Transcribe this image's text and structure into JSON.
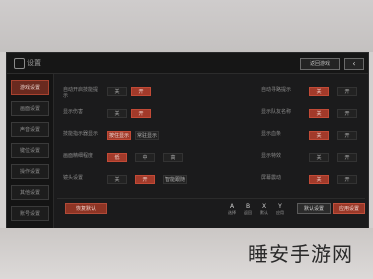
{
  "window": {
    "title": "设置",
    "tab": "返回游戏",
    "back_icon": "back-arrow-icon"
  },
  "sidebar": {
    "items": [
      {
        "label": "游戏设置",
        "active": true
      },
      {
        "label": "画面设置",
        "active": false
      },
      {
        "label": "声音设置",
        "active": false
      },
      {
        "label": "键位设置",
        "active": false
      },
      {
        "label": "操作设置",
        "active": false
      },
      {
        "label": "其他设置",
        "active": false
      },
      {
        "label": "账号设置",
        "active": false
      }
    ]
  },
  "settings_left": [
    {
      "label": "自动开启技能提示",
      "options": [
        "关",
        "开"
      ],
      "selected": 1
    },
    {
      "label": "显示伤害",
      "options": [
        "关",
        "开"
      ],
      "selected": 1
    },
    {
      "label": "技能指示器显示",
      "options": [
        "按住显示",
        "常驻显示"
      ],
      "selected": 0
    },
    {
      "label": "画面精细程度",
      "options": [
        "低",
        "中",
        "高"
      ],
      "selected": 0
    },
    {
      "label": "镜头设置",
      "options": [
        "关",
        "开",
        "智能跟随"
      ],
      "selected": 1
    }
  ],
  "settings_right": [
    {
      "label": "自动寻路提示",
      "options": [
        "关",
        "开"
      ],
      "selected": 0
    },
    {
      "label": "显示队友名称",
      "options": [
        "关",
        "开"
      ],
      "selected": 0
    },
    {
      "label": "显示血条",
      "options": [
        "关",
        "开"
      ],
      "selected": 0
    },
    {
      "label": "显示特效",
      "options": [
        "关",
        "开"
      ],
      "selected": 0
    },
    {
      "label": "屏幕震动",
      "options": [
        "关",
        "开"
      ],
      "selected": 0
    }
  ],
  "footer": {
    "left_button": "恢复默认",
    "hints": [
      {
        "icon": "A",
        "label": "选择"
      },
      {
        "icon": "B",
        "label": "返回"
      },
      {
        "icon": "X",
        "label": "默认"
      },
      {
        "icon": "Y",
        "label": "应用"
      }
    ],
    "default_button": "默认设置",
    "apply_button": "应用设置"
  },
  "watermark": "睡安手游网",
  "colors": {
    "accent": "#a23a2a",
    "window_bg": "#1b1b1c"
  }
}
